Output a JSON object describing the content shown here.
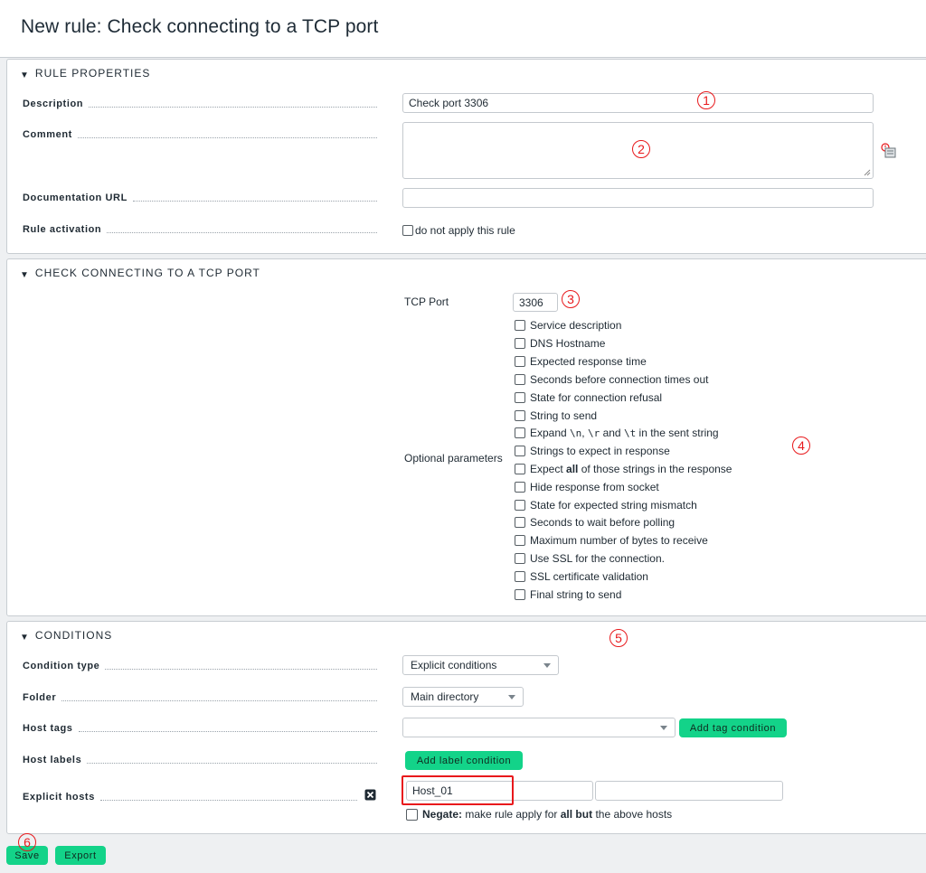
{
  "page": {
    "title": "New rule: Check connecting to a TCP port"
  },
  "rule_properties": {
    "title": "RULE PROPERTIES",
    "description_label": "Description",
    "description_value": "Check port 3306",
    "comment_label": "Comment",
    "comment_value": "",
    "doc_url_label": "Documentation URL",
    "doc_url_value": "",
    "activation_label": "Rule activation",
    "activation_checkbox": "do not apply this rule"
  },
  "tcp": {
    "title": "CHECK CONNECTING TO A TCP PORT",
    "port_label": "TCP Port",
    "port_value": "3306",
    "optional_label": "Optional parameters",
    "opt": {
      "service_description": "Service description",
      "dns_hostname": "DNS Hostname",
      "expected_response_time": "Expected response time",
      "seconds_timeout": "Seconds before connection times out",
      "state_refusal": "State for connection refusal",
      "string_to_send": "String to send",
      "expand_prefix": "Expand",
      "expand_n": "\\n",
      "expand_sep": ",",
      "expand_r": "\\r",
      "expand_and": "and",
      "expand_t": "\\t",
      "expand_suffix": "in the sent string",
      "strings_expect": "Strings to expect in response",
      "expect_all_prefix": "Expect",
      "expect_all_bold": "all",
      "expect_all_suffix": "of those strings in the response",
      "hide_response": "Hide response from socket",
      "state_mismatch": "State for expected string mismatch",
      "seconds_wait": "Seconds to wait before polling",
      "max_bytes": "Maximum number of bytes to receive",
      "use_ssl": "Use SSL for the connection.",
      "ssl_validation": "SSL certificate validation",
      "final_string": "Final string to send"
    }
  },
  "conditions": {
    "title": "CONDITIONS",
    "condition_type_label": "Condition type",
    "condition_type_value": "Explicit conditions",
    "folder_label": "Folder",
    "folder_value": "Main directory",
    "host_tags_label": "Host tags",
    "host_tags_value": "",
    "add_tag_button": "Add tag condition",
    "host_labels_label": "Host labels",
    "add_label_button": "Add label condition",
    "explicit_hosts_label": "Explicit hosts",
    "host_1": "Host_01",
    "host_2": "",
    "host_3": "",
    "negate_bold": "Negate:",
    "negate_text_1": "make rule apply for",
    "negate_bold_2": "all but",
    "negate_text_2": "the above hosts"
  },
  "footer": {
    "save": "Save",
    "export": "Export"
  },
  "annotations": [
    "1",
    "2",
    "3",
    "4",
    "5",
    "6"
  ],
  "colors": {
    "accent_green": "#13d389",
    "annotation_red": "#e8191c"
  }
}
